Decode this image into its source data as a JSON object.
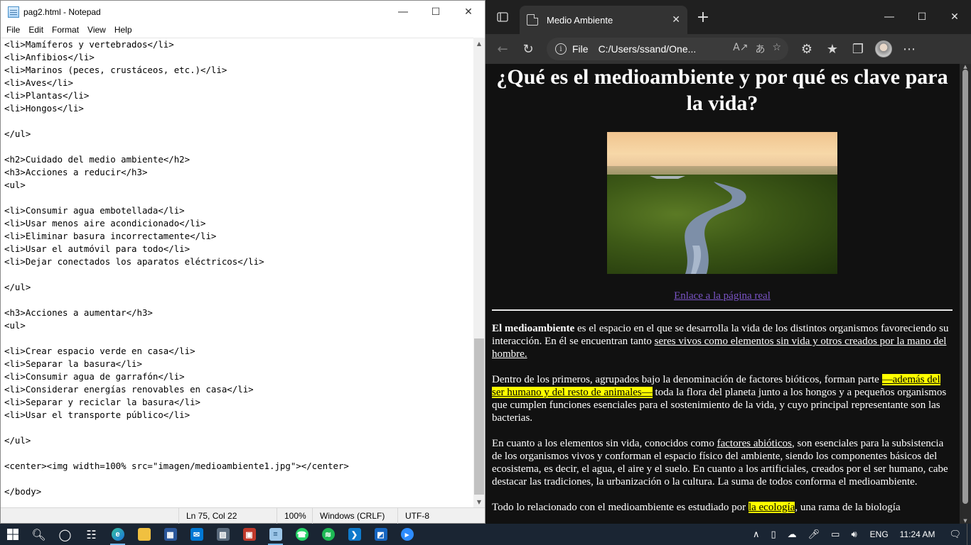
{
  "notepad": {
    "title": "pag2.html - Notepad",
    "menu": [
      "File",
      "Edit",
      "Format",
      "View",
      "Help"
    ],
    "lines": [
      "<li>Mamíferos y vertebrados</li>",
      "<li>Anfibios</li>",
      "<li>Marinos (peces, crustáceos, etc.)</li>",
      "<li>Aves</li>",
      "<li>Plantas</li>",
      "<li>Hongos</li>",
      "",
      "</ul>",
      "",
      "<h2>Cuidado del medio ambiente</h2>",
      "<h3>Acciones a reducir</h3>",
      "<ul>",
      "",
      "<li>Consumir agua embotellada</li>",
      "<li>Usar menos aire acondicionado</li>",
      "<li>Eliminar basura incorrectamente</li>",
      "<li>Usar el autmóvil para todo</li>",
      "<li>Dejar conectados los aparatos eléctricos</li>",
      "",
      "</ul>",
      "",
      "<h3>Acciones a aumentar</h3>",
      "<ul>",
      "",
      "<li>Crear espacio verde en casa</li>",
      "<li>Separar la basura</li>",
      "<li>Consumir agua de garrafón</li>",
      "<li>Considerar energías renovables en casa</li>",
      "<li>Separar y reciclar la basura</li>",
      "<li>Usar el transporte público</li>",
      "",
      "</ul>",
      "",
      "<center><img width=100% src=\"imagen/medioambiente1.jpg\"></center>",
      "",
      "</body>"
    ],
    "status": {
      "position": "Ln 75, Col 22",
      "zoom": "100%",
      "line_ending": "Windows (CRLF)",
      "encoding": "UTF-8"
    }
  },
  "edge": {
    "tab_title": "Medio Ambiente",
    "address_scheme": "File",
    "address_url": "C:/Users/ssand/One...",
    "page": {
      "title": "¿Qué es el medioambiente y por qué es clave para la vida?",
      "link": "Enlace a la página real",
      "p1": {
        "bold": "El medioambiente",
        "text": " es el espacio en el que se desarrolla la vida de los distintos organismos favoreciendo su interacción. En él se encuentran tanto ",
        "underlined": "seres vivos como elementos sin vida y otros creados por la mano del hombre."
      },
      "p2": {
        "before": "Dentro de los primeros, agrupados bajo la denominación de factores bióticos, forman parte ",
        "highlight": "—además del ser humano y del resto de animales—",
        "after": " toda la flora del planeta junto a los hongos y a pequeños organismos que cumplen funciones esenciales para el sostenimiento de la vida, y cuyo principal representante son las bacterias."
      },
      "p3": {
        "before": "En cuanto a los elementos sin vida, conocidos como ",
        "underlined": "factores abióticos",
        "after": ", son esenciales para la subsistencia de los organismos vivos y conforman el espacio físico del ambiente, siendo los componentes básicos del ecosistema, es decir, el agua, el aire y el suelo. En cuanto a los artificiales, creados por el ser humano, cabe destacar las tradiciones, la urbanización o la cultura. La suma de todos conforma el medioambiente."
      },
      "p4": {
        "before": "Todo lo relacionado con el medioambiente es estudiado por ",
        "highlight": "la ecología",
        "after": ", una rama de la biología"
      }
    }
  },
  "taskbar": {
    "language": "ENG",
    "time": "11:24 AM"
  },
  "colors": {
    "link_visited": "#7b55c7",
    "highlight": "#ffff00",
    "taskbar": "#1a2533",
    "edge_chrome": "#202020"
  }
}
